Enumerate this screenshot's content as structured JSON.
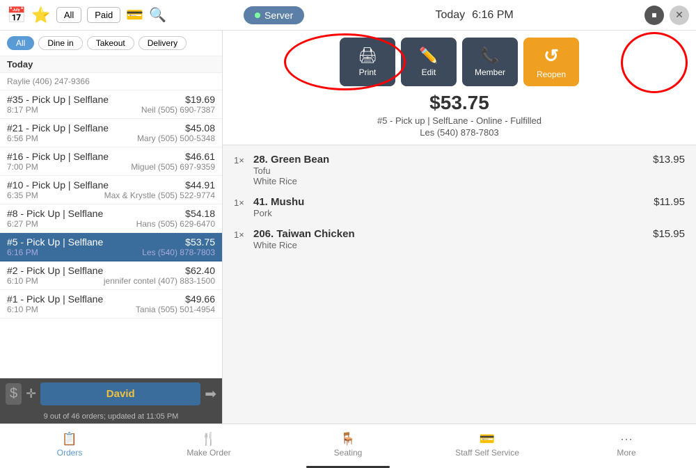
{
  "header": {
    "date": "Today",
    "time": "6:16 PM",
    "server_label": "Server",
    "stop_icon": "⏹",
    "close_icon": "✕"
  },
  "filters": {
    "options": [
      "All",
      "Dine in",
      "Takeout",
      "Delivery"
    ],
    "active": "All"
  },
  "orders": {
    "section_label": "Today",
    "items": [
      {
        "id": "#35",
        "label": "#35 - Pick Up | Selflane",
        "price": "$19.69",
        "time": "8:17 PM",
        "customer": "Neil (505) 690-7387",
        "selected": false
      },
      {
        "id": "#21",
        "label": "#21 - Pick Up | Selflane",
        "price": "$45.08",
        "time": "6:56 PM",
        "customer": "Mary (505) 500-5348",
        "selected": false
      },
      {
        "id": "#16",
        "label": "#16 - Pick Up | Selflane",
        "price": "$46.61",
        "time": "7:00 PM",
        "customer": "Miguel (505) 697-9359",
        "selected": false
      },
      {
        "id": "#10",
        "label": "#10 - Pick Up | Selflane",
        "price": "$44.91",
        "time": "6:35 PM",
        "customer": "Max & Krystle (505) 522-9774",
        "selected": false
      },
      {
        "id": "#8",
        "label": "#8 - Pick Up | Selflane",
        "price": "$54.18",
        "time": "6:27 PM",
        "customer": "Hans (505) 629-6470",
        "selected": false
      },
      {
        "id": "#5",
        "label": "#5 - Pick Up | Selflane",
        "price": "$53.75",
        "time": "6:16 PM",
        "customer": "Les (540) 878-7803",
        "selected": true
      },
      {
        "id": "#2",
        "label": "#2 - Pick Up | Selflane",
        "price": "$62.40",
        "time": "6:10 PM",
        "customer": "jennifer contel (407) 883-1500",
        "selected": false
      },
      {
        "id": "#1",
        "label": "#1 - Pick Up | Selflane",
        "price": "$49.66",
        "time": "6:10 PM",
        "customer": "Tania (505) 501-4954",
        "selected": false
      }
    ],
    "status": "9 out of 46 orders; updated at 11:05 PM"
  },
  "staff": {
    "name": "David"
  },
  "detail": {
    "total": "$53.75",
    "order_id": "#5 - Pick up | SelfLane - Online - Fulfilled",
    "customer": "Les (540) 878-7803",
    "actions": [
      {
        "id": "print",
        "label": "Print",
        "icon": "🖨",
        "style": "dark"
      },
      {
        "id": "edit",
        "label": "Edit",
        "icon": "✏️",
        "style": "dark"
      },
      {
        "id": "member",
        "label": "Member",
        "icon": "📞",
        "style": "dark"
      },
      {
        "id": "reopen",
        "label": "Reopen",
        "icon": "↺",
        "style": "orange"
      }
    ],
    "items": [
      {
        "qty": "1×",
        "number": "28.",
        "name": "Green Bean",
        "mods": [
          "Tofu",
          "White Rice"
        ],
        "price": "$13.95"
      },
      {
        "qty": "1×",
        "number": "41.",
        "name": "Mushu",
        "mods": [
          "Pork"
        ],
        "price": "$11.95"
      },
      {
        "qty": "1×",
        "number": "206.",
        "name": "Taiwan Chicken",
        "mods": [
          "White Rice"
        ],
        "price": "$15.95"
      }
    ]
  },
  "bottom_nav": {
    "items": [
      {
        "id": "orders",
        "label": "Orders",
        "icon": "📋",
        "active": true
      },
      {
        "id": "make-order",
        "label": "Make Order",
        "icon": "🍴",
        "active": false
      },
      {
        "id": "seating",
        "label": "Seating",
        "icon": "🪑",
        "active": false
      },
      {
        "id": "staff-self-service",
        "label": "Staff Self Service",
        "icon": "💳",
        "active": false
      },
      {
        "id": "more",
        "label": "More",
        "icon": "···",
        "active": false
      }
    ]
  }
}
